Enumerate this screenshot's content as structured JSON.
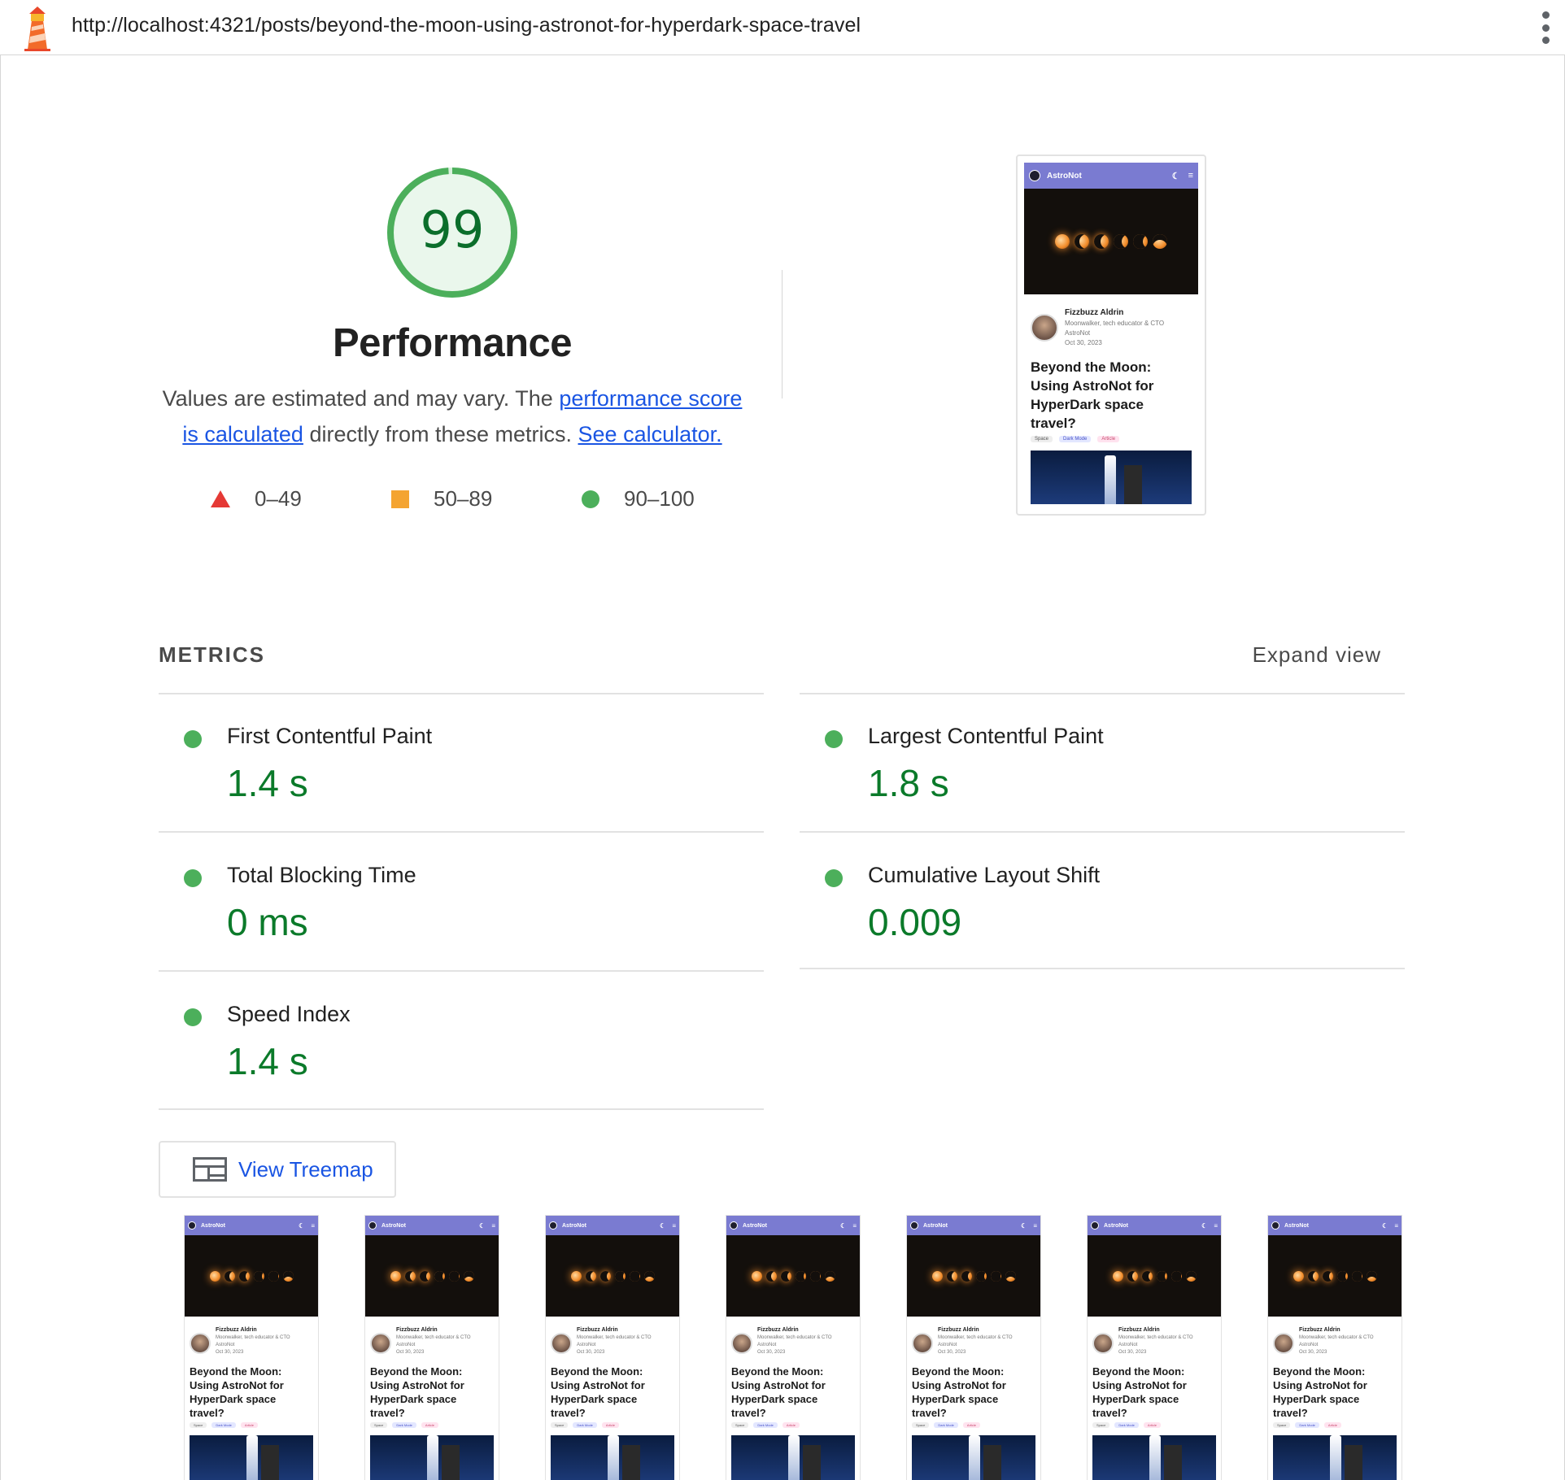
{
  "browser": {
    "url": "http://localhost:4321/posts/beyond-the-moon-using-astronot-for-hyperdark-space-travel"
  },
  "score": {
    "value": "99",
    "fraction": 0.99,
    "title": "Performance",
    "description_before": "Values are estimated and may vary. The ",
    "link_score": "performance score is calculated",
    "description_middle": " directly from these metrics. ",
    "link_calculator": "See calculator."
  },
  "legend": {
    "fail": "0–49",
    "average": "50–89",
    "pass": "90–100"
  },
  "colors": {
    "pass": "#4caf5b",
    "average": "#f4a431",
    "fail": "#e53935",
    "accent_link": "#1a55e3",
    "score_text": "#0b6e2b"
  },
  "screenshot": {
    "site_name": "AstroNot",
    "author_name": "Fizzbuzz Aldrin",
    "author_role": "Moonwalker, tech educator & CTO",
    "author_org": "AstroNot",
    "date": "Oct 30, 2023",
    "post_title": "Beyond the Moon: Using AstroNot for HyperDark space travel?",
    "tags": [
      "Space",
      "Dark Mode",
      "Article"
    ],
    "icons": [
      "moon-icon",
      "menu-icon"
    ]
  },
  "metrics": {
    "header": "METRICS",
    "expand_label": "Expand view",
    "items": [
      {
        "label": "First Contentful Paint",
        "value": "1.4 s"
      },
      {
        "label": "Largest Contentful Paint",
        "value": "1.8 s"
      },
      {
        "label": "Total Blocking Time",
        "value": "0 ms"
      },
      {
        "label": "Cumulative Layout Shift",
        "value": "0.009"
      },
      {
        "label": "Speed Index",
        "value": "1.4 s"
      }
    ]
  },
  "treemap": {
    "label": "View Treemap",
    "icon": "treemap-icon"
  },
  "filmstrip": {
    "frame_count": 7
  }
}
